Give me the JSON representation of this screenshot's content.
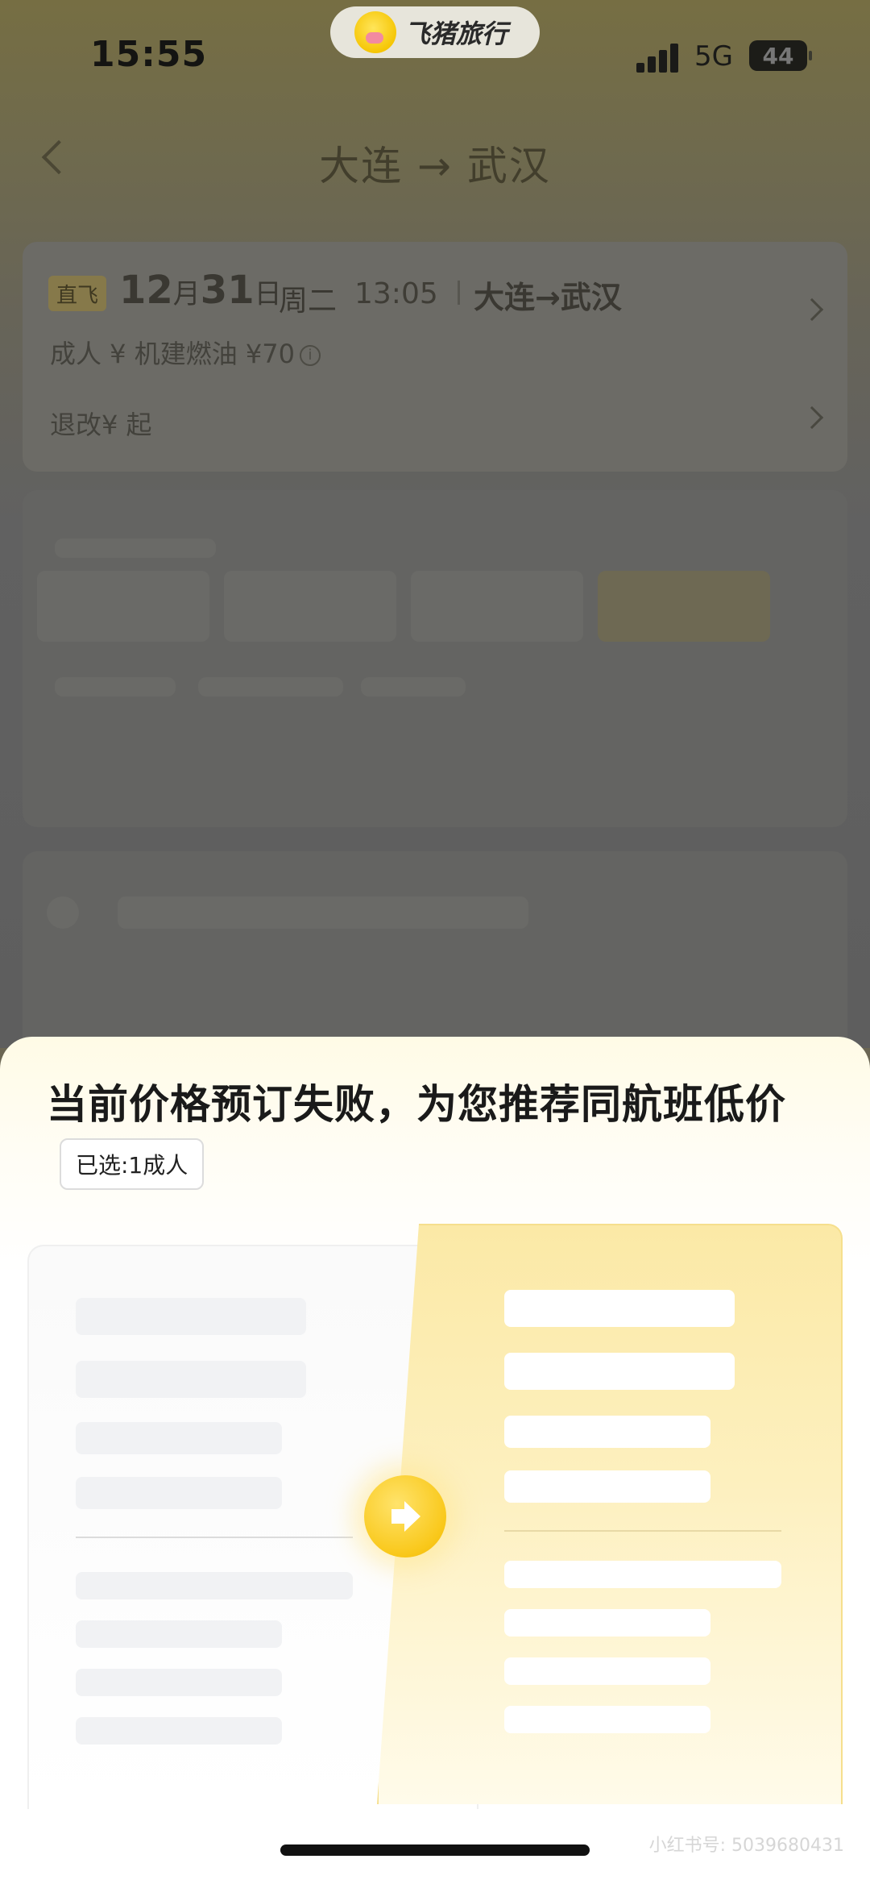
{
  "status_bar": {
    "time": "15:55",
    "network": "5G",
    "battery": "44",
    "icons": [
      "signal-icon",
      "battery-icon"
    ]
  },
  "app_pill": {
    "name": "飞猪旅行",
    "icon": "pig-logo-icon"
  },
  "nav": {
    "title": "大连 → 武汉",
    "back_icon": "chevron-left-icon"
  },
  "flight": {
    "tag": "直飞",
    "month": "12",
    "month_unit": "月",
    "day": "31",
    "day_unit": "日",
    "weekday": "周二",
    "time": "13:05",
    "route": "大连→武汉",
    "price_line": "成人 ¥  机建燃油 ¥70",
    "refund": "退改¥ 起"
  },
  "sheet": {
    "title": "当前价格预订失败，为您推荐同航班低价",
    "selected": "已选:1成人",
    "arrow_icon": "arrow-right-icon"
  },
  "watermark": "小红书号: 5039680431",
  "colors": {
    "accent": "#f9c81a",
    "sheet_bg": "#fffbe6"
  }
}
